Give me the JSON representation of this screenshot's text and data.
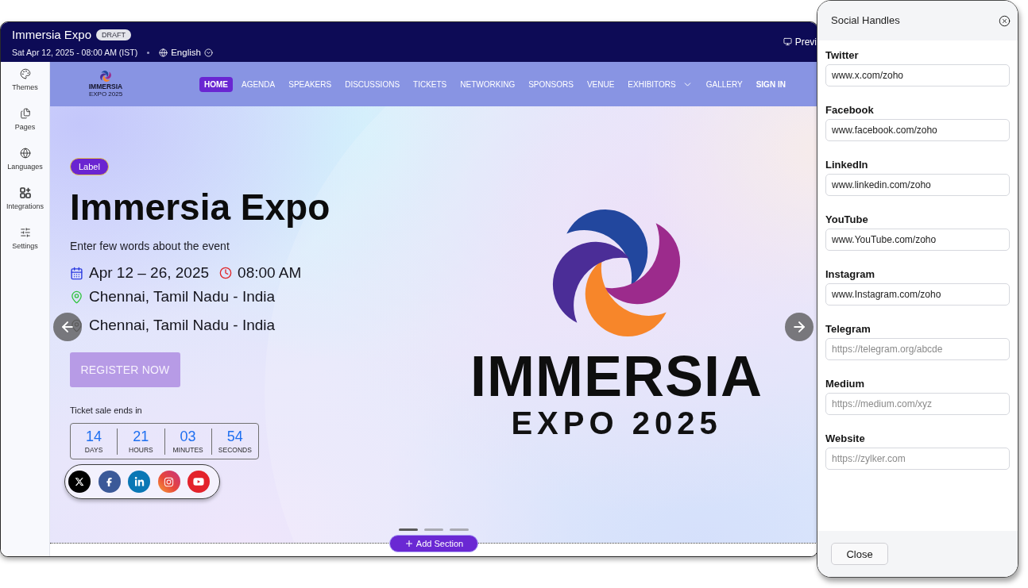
{
  "app_bar": {
    "title": "Immersia Expo",
    "status_badge": "DRAFT",
    "schedule": "Sat Apr 12, 2025 - 08:00 AM (IST)",
    "language": "English",
    "preview_label": "Previ"
  },
  "sidebar": {
    "items": [
      {
        "label": "Themes"
      },
      {
        "label": "Pages"
      },
      {
        "label": "Languages"
      },
      {
        "label": "Integrations"
      },
      {
        "label": "Settings"
      }
    ]
  },
  "site_nav": {
    "logo_title": "IMMERSIA",
    "logo_subtitle": "EXPO 2025",
    "items": [
      {
        "label": "HOME",
        "kind": "link",
        "selected": true
      },
      {
        "label": "AGENDA",
        "kind": "link",
        "selected": false
      },
      {
        "label": "SPEAKERS",
        "kind": "link",
        "selected": false
      },
      {
        "label": "DISCUSSIONS",
        "kind": "link",
        "selected": false
      },
      {
        "label": "TICKETS",
        "kind": "link",
        "selected": false
      },
      {
        "label": "NETWORKING",
        "kind": "link",
        "selected": false
      },
      {
        "label": "SPONSORS",
        "kind": "link",
        "selected": false
      },
      {
        "label": "VENUE",
        "kind": "link",
        "selected": false
      },
      {
        "label": "EXHIBITORS",
        "kind": "menu",
        "selected": false
      },
      {
        "label": "GALLERY",
        "kind": "link",
        "selected": false
      },
      {
        "label": "SIGN IN",
        "kind": "action",
        "selected": false
      }
    ]
  },
  "hero": {
    "badge": "Label",
    "title": "Immersia Expo",
    "tagline": "Enter few words about the event",
    "date": "Apr 12 – 26, 2025",
    "time": "08:00 AM",
    "locations": [
      "Chennai, Tamil Nadu - India",
      "Chennai, Tamil Nadu - India"
    ],
    "register_button": "REGISTER NOW",
    "countdown_caption": "Ticket sale ends in",
    "countdown": [
      {
        "value": "14",
        "unit": "DAYS"
      },
      {
        "value": "21",
        "unit": "HOURS"
      },
      {
        "value": "03",
        "unit": "MINUTES"
      },
      {
        "value": "54",
        "unit": "SECONDS"
      }
    ],
    "social_links": [
      {
        "kind": "x"
      },
      {
        "kind": "facebook"
      },
      {
        "kind": "linkedin"
      },
      {
        "kind": "instagram"
      },
      {
        "kind": "youtube"
      }
    ],
    "logo_title": "IMMERSIA",
    "logo_subtitle": "EXPO 2025",
    "slide_indicators": [
      {
        "selected": true
      },
      {
        "selected": false
      },
      {
        "selected": false
      }
    ]
  },
  "add_section_button": "Add Section",
  "social_handles_panel": {
    "title": "Social Handles",
    "fields": [
      {
        "label": "Twitter",
        "value": "www.x.com/zoho"
      },
      {
        "label": "Facebook",
        "value": "www.facebook.com/zoho"
      },
      {
        "label": "LinkedIn",
        "value": "www.linkedin.com/zoho"
      },
      {
        "label": "YouTube",
        "value": "www.YouTube.com/zoho"
      },
      {
        "label": "Instagram",
        "value": "www.Instagram.com/zoho"
      },
      {
        "label": "Telegram",
        "placeholder": "https://telegram.org/abcde"
      },
      {
        "label": "Medium",
        "placeholder": "https://medium.com/xyz"
      },
      {
        "label": "Website",
        "placeholder": "https://zylker.com"
      }
    ],
    "close_button": "Close"
  }
}
